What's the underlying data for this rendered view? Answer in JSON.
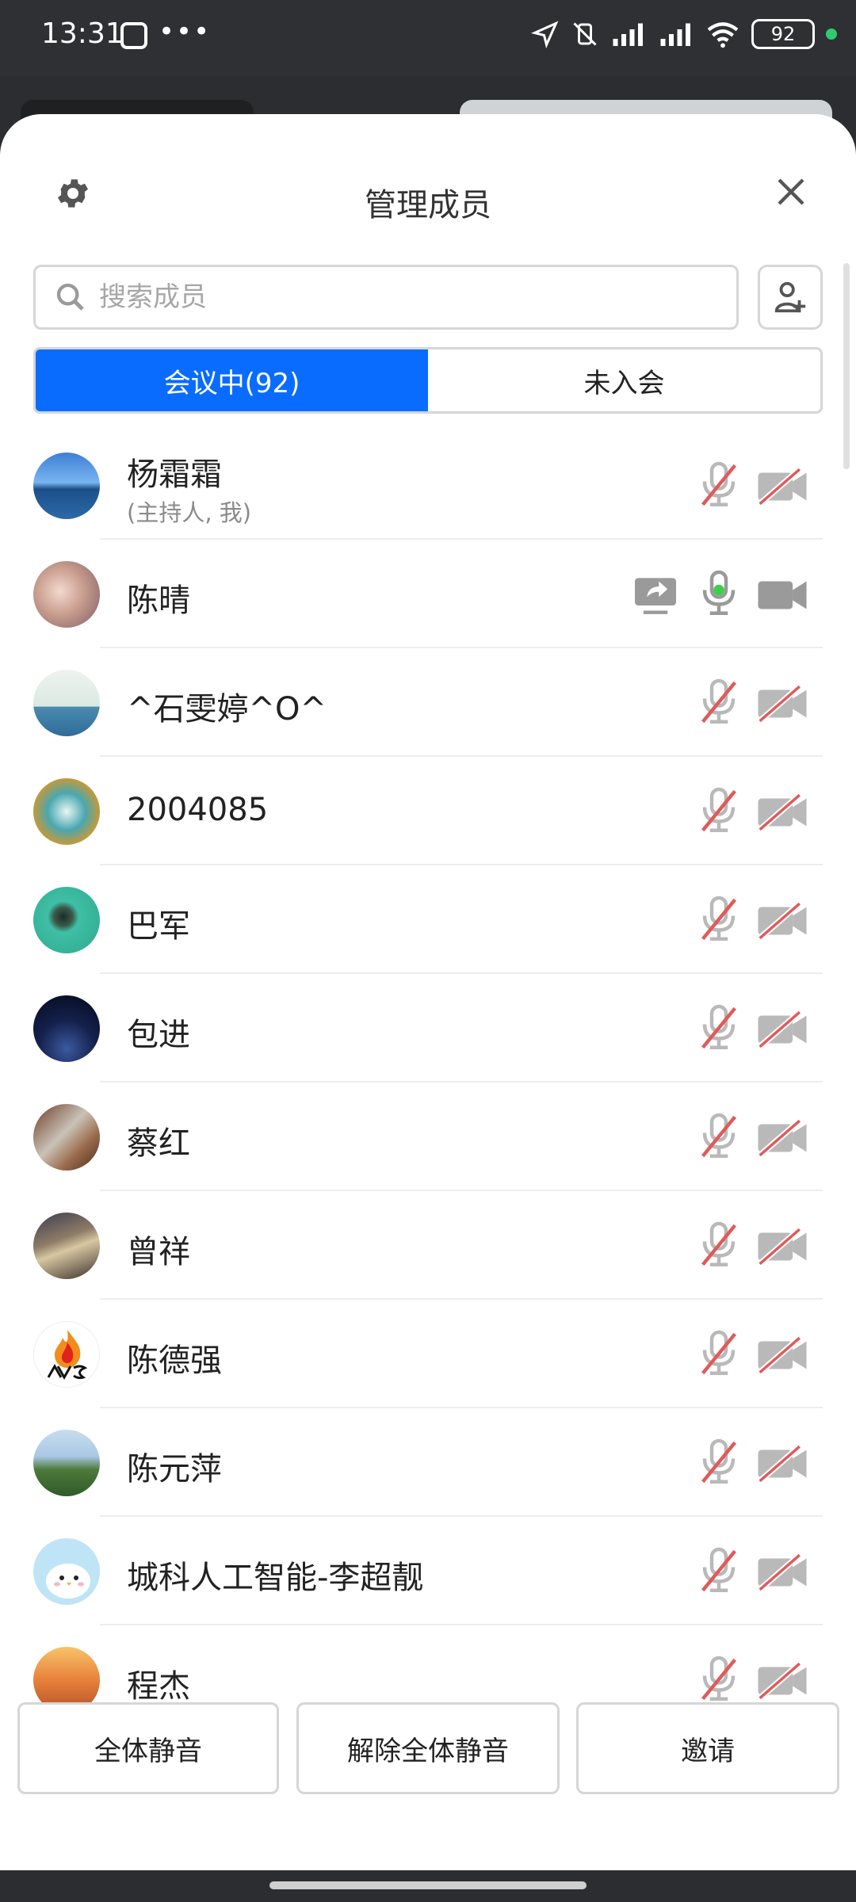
{
  "status_bar": {
    "time": "13:31",
    "battery": "92",
    "dots": "•••"
  },
  "header": {
    "title": "管理成员"
  },
  "search": {
    "placeholder": "搜索成员"
  },
  "tabs": [
    {
      "label": "会议中(92)",
      "active": true
    },
    {
      "label": "未入会",
      "active": false
    }
  ],
  "members": [
    {
      "name": "杨霜霜",
      "subtitle": "(主持人, 我)",
      "mic": "muted",
      "camera": "off",
      "sharing": false
    },
    {
      "name": "陈晴",
      "subtitle": "",
      "mic": "on",
      "camera": "on",
      "sharing": true
    },
    {
      "name": "^石雯婷^O^",
      "subtitle": "",
      "mic": "muted",
      "camera": "off",
      "sharing": false
    },
    {
      "name": "2004085",
      "subtitle": "",
      "mic": "muted",
      "camera": "off",
      "sharing": false
    },
    {
      "name": "巴军",
      "subtitle": "",
      "mic": "muted",
      "camera": "off",
      "sharing": false
    },
    {
      "name": "包进",
      "subtitle": "",
      "mic": "muted",
      "camera": "off",
      "sharing": false
    },
    {
      "name": "蔡红",
      "subtitle": "",
      "mic": "muted",
      "camera": "off",
      "sharing": false
    },
    {
      "name": "曾祥",
      "subtitle": "",
      "mic": "muted",
      "camera": "off",
      "sharing": false
    },
    {
      "name": "陈德强",
      "subtitle": "",
      "mic": "muted",
      "camera": "off",
      "sharing": false
    },
    {
      "name": "陈元萍",
      "subtitle": "",
      "mic": "muted",
      "camera": "off",
      "sharing": false
    },
    {
      "name": "城科人工智能-李超靓",
      "subtitle": "",
      "mic": "muted",
      "camera": "off",
      "sharing": false
    },
    {
      "name": "程杰",
      "subtitle": "",
      "mic": "muted",
      "camera": "off",
      "sharing": false
    }
  ],
  "footer": {
    "mute_all": "全体静音",
    "unmute_all": "解除全体静音",
    "invite": "邀请"
  },
  "colors": {
    "accent": "#0a6cff",
    "mic_active": "#3ccf4e",
    "muted_slash": "#e05a5a"
  }
}
